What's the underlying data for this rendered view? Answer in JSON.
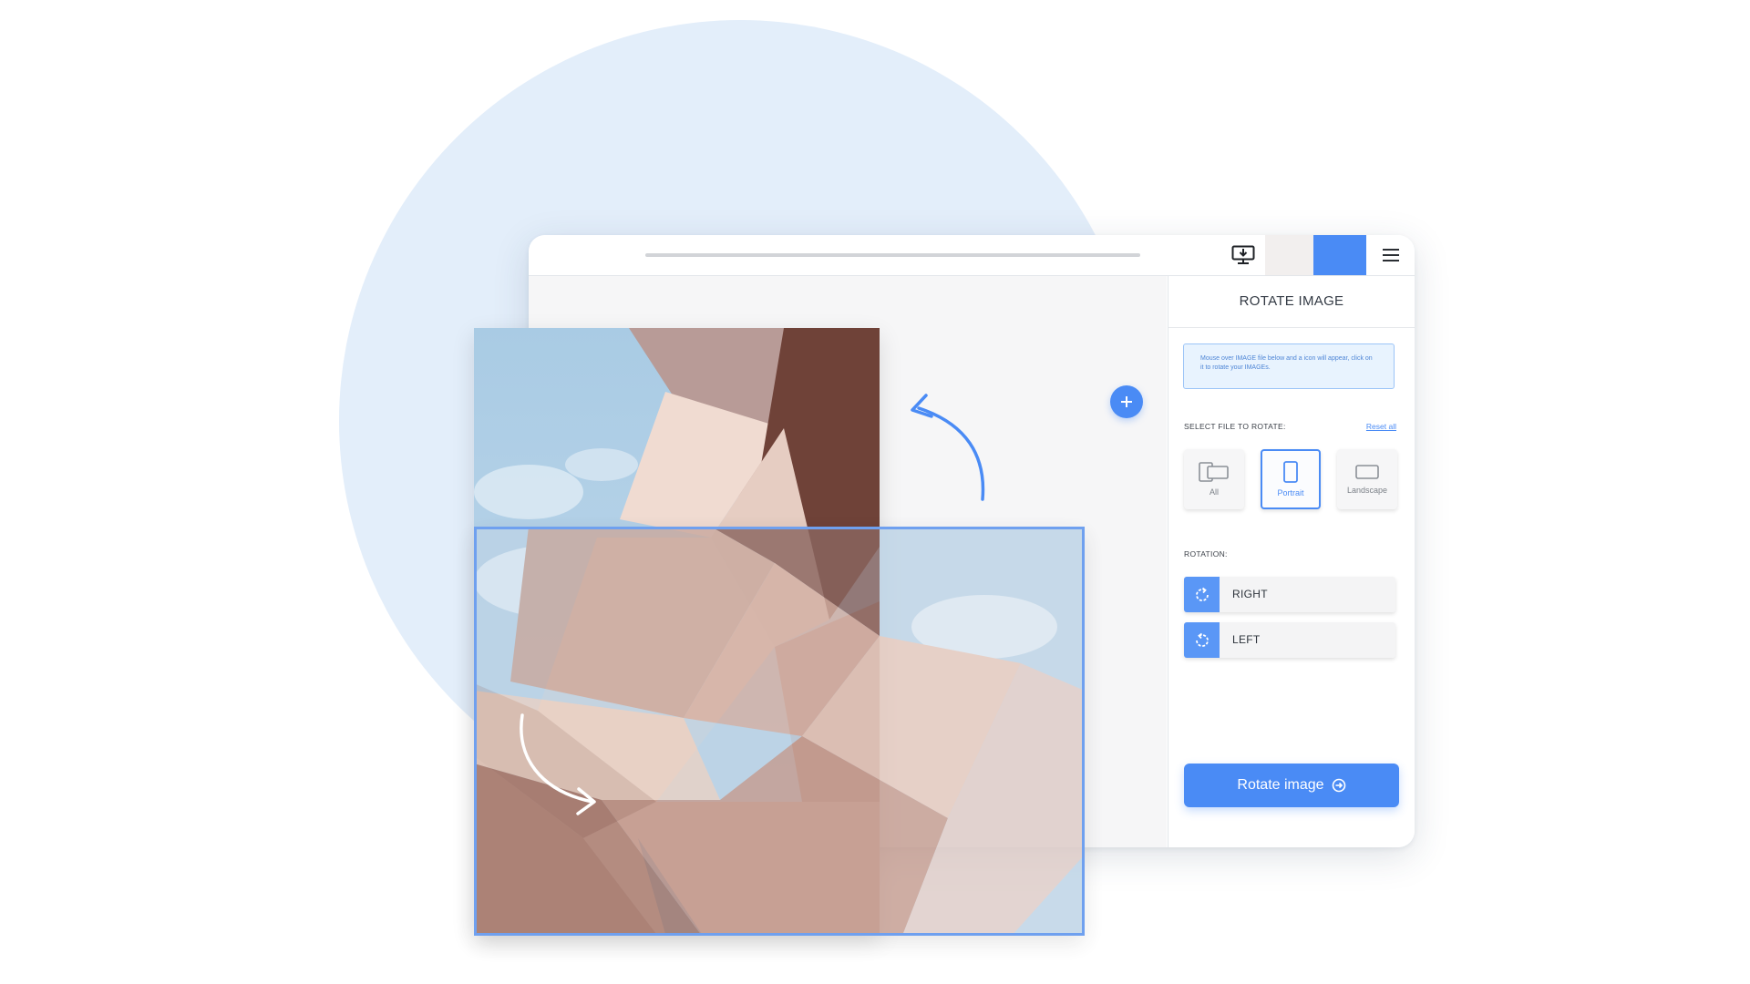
{
  "sidebar": {
    "title": "ROTATE IMAGE",
    "info": "Mouse over IMAGE file below and a icon will appear, click on it to rotate your IMAGEs.",
    "select_label": "SELECT FILE TO ROTATE:",
    "reset_label": "Reset all",
    "orientation_options": [
      {
        "label": "All",
        "icon": "all-files-icon"
      },
      {
        "label": "Portrait",
        "icon": "portrait-icon"
      },
      {
        "label": "Landscape",
        "icon": "landscape-icon"
      }
    ],
    "selected_orientation": "Portrait",
    "rotation_label": "ROTATION:",
    "rotation_options": [
      {
        "label": "RIGHT",
        "icon": "rotate-right-icon"
      },
      {
        "label": "LEFT",
        "icon": "rotate-left-icon"
      }
    ],
    "primary_button": "Rotate image",
    "primary_button_icon": "arrow-right-circle-icon"
  },
  "toolbar": {
    "icons": [
      "desktop-download-icon",
      "hamburger-menu-icon"
    ]
  },
  "colors": {
    "accent": "#4a8bf5",
    "background_circle": "#e3eefa",
    "info_border": "#9cc4f7"
  }
}
